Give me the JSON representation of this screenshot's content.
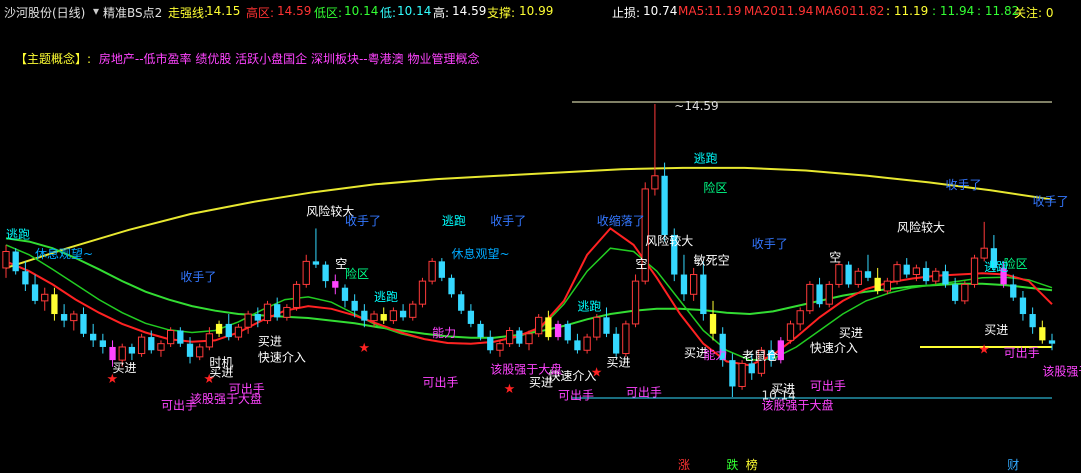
{
  "header": {
    "stock": "沙河股份(日线)",
    "indicator": "精准BS点2",
    "strong_label": "走强线:",
    "strong_value": "14.15",
    "high_zone_label": "高区:",
    "high_zone_value": "14.59",
    "low_zone_label": "低区:",
    "low_zone_value": "10.14",
    "low_label": "低:",
    "low_value": "10.14",
    "high_label": "高:",
    "high_value": "14.59",
    "support_label": "支撑:",
    "support_value": "10.99",
    "stop_label": "止损:",
    "stop_value": "10.74",
    "ma5_label": "MA5:",
    "ma5_value": "11.19",
    "ma20_label": "MA20:",
    "ma20_value": "11.94",
    "ma60_label": "MA60:",
    "ma60_value": "11.82",
    "extra1": ": 11.19",
    "extra2": ": 11.94",
    "extra3": ": 11.82",
    "focus_label": "关注: 0"
  },
  "concept": {
    "prefix": "【主题概念】:",
    "text": "房地产--低市盈率 绩优股 活跃小盘国企 深圳板块--粤港澳 物业管理概念"
  },
  "colors": {
    "up": "#ff3a3a",
    "down": "#35d8ff",
    "yellow": "#ffff33",
    "magenta": "#ff44ff",
    "ma_yellow": "#e8e830",
    "ma_green": "#33dd33",
    "ma_red": "#ff2222",
    "white": "#ffffff",
    "cyan": "#00ffff"
  },
  "chart_data": {
    "type": "candlestick",
    "price_markers": {
      "high": "14.59",
      "low": "10.14"
    },
    "candles": [
      {
        "o": 12.1,
        "h": 12.45,
        "l": 11.95,
        "c": 12.35
      },
      {
        "o": 12.35,
        "h": 12.4,
        "l": 12.0,
        "c": 12.05
      },
      {
        "o": 12.05,
        "h": 12.2,
        "l": 11.75,
        "c": 11.85
      },
      {
        "o": 11.85,
        "h": 12.0,
        "l": 11.55,
        "c": 11.6
      },
      {
        "o": 11.6,
        "h": 11.8,
        "l": 11.45,
        "c": 11.7
      },
      {
        "o": 11.7,
        "h": 11.8,
        "l": 11.3,
        "c": 11.4
      },
      {
        "o": 11.4,
        "h": 11.55,
        "l": 11.2,
        "c": 11.3
      },
      {
        "o": 11.3,
        "h": 11.45,
        "l": 11.15,
        "c": 11.4
      },
      {
        "o": 11.4,
        "h": 11.5,
        "l": 11.05,
        "c": 11.1
      },
      {
        "o": 11.1,
        "h": 11.25,
        "l": 10.9,
        "c": 11.0
      },
      {
        "o": 11.0,
        "h": 11.1,
        "l": 10.8,
        "c": 10.9
      },
      {
        "o": 10.9,
        "h": 11.0,
        "l": 10.6,
        "c": 10.7
      },
      {
        "o": 10.7,
        "h": 10.95,
        "l": 10.6,
        "c": 10.9
      },
      {
        "o": 10.9,
        "h": 10.95,
        "l": 10.7,
        "c": 10.8
      },
      {
        "o": 10.8,
        "h": 11.1,
        "l": 10.75,
        "c": 11.05
      },
      {
        "o": 11.05,
        "h": 11.15,
        "l": 10.8,
        "c": 10.85
      },
      {
        "o": 10.85,
        "h": 11.0,
        "l": 10.75,
        "c": 10.95
      },
      {
        "o": 10.95,
        "h": 11.2,
        "l": 10.9,
        "c": 11.15
      },
      {
        "o": 11.15,
        "h": 11.2,
        "l": 10.9,
        "c": 10.95
      },
      {
        "o": 10.95,
        "h": 11.05,
        "l": 10.65,
        "c": 10.75
      },
      {
        "o": 10.75,
        "h": 10.95,
        "l": 10.7,
        "c": 10.9
      },
      {
        "o": 10.9,
        "h": 11.2,
        "l": 10.85,
        "c": 11.1
      },
      {
        "o": 11.1,
        "h": 11.3,
        "l": 11.05,
        "c": 11.25
      },
      {
        "o": 11.25,
        "h": 11.4,
        "l": 11.0,
        "c": 11.05
      },
      {
        "o": 11.05,
        "h": 11.25,
        "l": 11.0,
        "c": 11.2
      },
      {
        "o": 11.2,
        "h": 11.45,
        "l": 11.1,
        "c": 11.4
      },
      {
        "o": 11.4,
        "h": 11.5,
        "l": 11.2,
        "c": 11.3
      },
      {
        "o": 11.3,
        "h": 11.6,
        "l": 11.25,
        "c": 11.55
      },
      {
        "o": 11.55,
        "h": 11.65,
        "l": 11.3,
        "c": 11.35
      },
      {
        "o": 11.35,
        "h": 11.55,
        "l": 11.3,
        "c": 11.5
      },
      {
        "o": 11.5,
        "h": 11.9,
        "l": 11.45,
        "c": 11.85
      },
      {
        "o": 11.85,
        "h": 12.3,
        "l": 11.8,
        "c": 12.2
      },
      {
        "o": 12.2,
        "h": 12.7,
        "l": 12.1,
        "c": 12.15
      },
      {
        "o": 12.15,
        "h": 12.2,
        "l": 11.8,
        "c": 11.9
      },
      {
        "o": 11.9,
        "h": 12.0,
        "l": 11.7,
        "c": 11.8
      },
      {
        "o": 11.8,
        "h": 11.85,
        "l": 11.5,
        "c": 11.6
      },
      {
        "o": 11.6,
        "h": 11.7,
        "l": 11.35,
        "c": 11.45
      },
      {
        "o": 11.45,
        "h": 11.55,
        "l": 11.2,
        "c": 11.3
      },
      {
        "o": 11.3,
        "h": 11.45,
        "l": 11.2,
        "c": 11.4
      },
      {
        "o": 11.4,
        "h": 11.5,
        "l": 11.25,
        "c": 11.3
      },
      {
        "o": 11.3,
        "h": 11.5,
        "l": 11.25,
        "c": 11.45
      },
      {
        "o": 11.45,
        "h": 11.55,
        "l": 11.3,
        "c": 11.35
      },
      {
        "o": 11.35,
        "h": 11.6,
        "l": 11.3,
        "c": 11.55
      },
      {
        "o": 11.55,
        "h": 11.95,
        "l": 11.5,
        "c": 11.9
      },
      {
        "o": 11.9,
        "h": 12.25,
        "l": 11.85,
        "c": 12.2
      },
      {
        "o": 12.2,
        "h": 12.25,
        "l": 11.9,
        "c": 11.95
      },
      {
        "o": 11.95,
        "h": 12.0,
        "l": 11.65,
        "c": 11.7
      },
      {
        "o": 11.7,
        "h": 11.75,
        "l": 11.4,
        "c": 11.45
      },
      {
        "o": 11.45,
        "h": 11.55,
        "l": 11.2,
        "c": 11.25
      },
      {
        "o": 11.25,
        "h": 11.3,
        "l": 11.0,
        "c": 11.05
      },
      {
        "o": 11.05,
        "h": 11.15,
        "l": 10.8,
        "c": 10.85
      },
      {
        "o": 10.85,
        "h": 11.0,
        "l": 10.75,
        "c": 10.95
      },
      {
        "o": 10.95,
        "h": 11.2,
        "l": 10.9,
        "c": 11.15
      },
      {
        "o": 11.15,
        "h": 11.2,
        "l": 10.9,
        "c": 10.95
      },
      {
        "o": 10.95,
        "h": 11.15,
        "l": 10.85,
        "c": 11.1
      },
      {
        "o": 11.1,
        "h": 11.4,
        "l": 11.05,
        "c": 11.35
      },
      {
        "o": 11.35,
        "h": 11.45,
        "l": 11.0,
        "c": 11.05
      },
      {
        "o": 11.05,
        "h": 11.3,
        "l": 11.0,
        "c": 11.25
      },
      {
        "o": 11.25,
        "h": 11.3,
        "l": 10.95,
        "c": 11.0
      },
      {
        "o": 11.0,
        "h": 11.1,
        "l": 10.8,
        "c": 10.85
      },
      {
        "o": 10.85,
        "h": 11.1,
        "l": 10.8,
        "c": 11.05
      },
      {
        "o": 11.05,
        "h": 11.4,
        "l": 11.0,
        "c": 11.35
      },
      {
        "o": 11.35,
        "h": 11.5,
        "l": 11.05,
        "c": 11.1
      },
      {
        "o": 11.1,
        "h": 11.2,
        "l": 10.75,
        "c": 10.8
      },
      {
        "o": 10.8,
        "h": 11.3,
        "l": 10.75,
        "c": 11.25
      },
      {
        "o": 11.25,
        "h": 12.0,
        "l": 11.2,
        "c": 11.9
      },
      {
        "o": 11.9,
        "h": 13.4,
        "l": 11.85,
        "c": 13.3
      },
      {
        "o": 13.3,
        "h": 14.59,
        "l": 13.2,
        "c": 13.5
      },
      {
        "o": 13.5,
        "h": 13.7,
        "l": 12.5,
        "c": 12.6
      },
      {
        "o": 12.6,
        "h": 12.7,
        "l": 11.9,
        "c": 12.0
      },
      {
        "o": 12.0,
        "h": 12.3,
        "l": 11.6,
        "c": 11.7
      },
      {
        "o": 11.7,
        "h": 12.1,
        "l": 11.6,
        "c": 12.0
      },
      {
        "o": 12.0,
        "h": 12.2,
        "l": 11.3,
        "c": 11.4
      },
      {
        "o": 11.4,
        "h": 11.6,
        "l": 11.0,
        "c": 11.1
      },
      {
        "o": 11.1,
        "h": 11.2,
        "l": 10.6,
        "c": 10.7
      },
      {
        "o": 10.7,
        "h": 10.8,
        "l": 10.14,
        "c": 10.3
      },
      {
        "o": 10.3,
        "h": 10.7,
        "l": 10.25,
        "c": 10.65
      },
      {
        "o": 10.65,
        "h": 10.8,
        "l": 10.4,
        "c": 10.5
      },
      {
        "o": 10.5,
        "h": 10.9,
        "l": 10.45,
        "c": 10.85
      },
      {
        "o": 10.85,
        "h": 11.0,
        "l": 10.6,
        "c": 10.7
      },
      {
        "o": 10.7,
        "h": 11.05,
        "l": 10.65,
        "c": 11.0
      },
      {
        "o": 11.0,
        "h": 11.3,
        "l": 10.95,
        "c": 11.25
      },
      {
        "o": 11.25,
        "h": 11.5,
        "l": 11.15,
        "c": 11.45
      },
      {
        "o": 11.45,
        "h": 11.9,
        "l": 11.4,
        "c": 11.85
      },
      {
        "o": 11.85,
        "h": 11.95,
        "l": 11.5,
        "c": 11.55
      },
      {
        "o": 11.55,
        "h": 11.9,
        "l": 11.5,
        "c": 11.85
      },
      {
        "o": 11.85,
        "h": 12.2,
        "l": 11.8,
        "c": 12.15
      },
      {
        "o": 12.15,
        "h": 12.2,
        "l": 11.8,
        "c": 11.85
      },
      {
        "o": 11.85,
        "h": 12.1,
        "l": 11.8,
        "c": 12.05
      },
      {
        "o": 12.05,
        "h": 12.3,
        "l": 11.9,
        "c": 11.95
      },
      {
        "o": 11.95,
        "h": 12.1,
        "l": 11.7,
        "c": 11.75
      },
      {
        "o": 11.75,
        "h": 11.95,
        "l": 11.7,
        "c": 11.9
      },
      {
        "o": 11.9,
        "h": 12.2,
        "l": 11.85,
        "c": 12.15
      },
      {
        "o": 12.15,
        "h": 12.25,
        "l": 11.95,
        "c": 12.0
      },
      {
        "o": 12.0,
        "h": 12.15,
        "l": 11.9,
        "c": 12.1
      },
      {
        "o": 12.1,
        "h": 12.2,
        "l": 11.85,
        "c": 11.9
      },
      {
        "o": 11.9,
        "h": 12.1,
        "l": 11.85,
        "c": 12.05
      },
      {
        "o": 12.05,
        "h": 12.15,
        "l": 11.8,
        "c": 11.85
      },
      {
        "o": 11.85,
        "h": 11.95,
        "l": 11.55,
        "c": 11.6
      },
      {
        "o": 11.6,
        "h": 11.9,
        "l": 11.55,
        "c": 11.85
      },
      {
        "o": 11.85,
        "h": 12.3,
        "l": 11.8,
        "c": 12.25
      },
      {
        "o": 12.25,
        "h": 12.8,
        "l": 12.2,
        "c": 12.4
      },
      {
        "o": 12.4,
        "h": 12.6,
        "l": 12.05,
        "c": 12.1
      },
      {
        "o": 12.1,
        "h": 12.2,
        "l": 11.8,
        "c": 11.85
      },
      {
        "o": 11.85,
        "h": 12.0,
        "l": 11.6,
        "c": 11.65
      },
      {
        "o": 11.65,
        "h": 11.75,
        "l": 11.3,
        "c": 11.4
      },
      {
        "o": 11.4,
        "h": 11.5,
        "l": 11.1,
        "c": 11.2
      },
      {
        "o": 11.2,
        "h": 11.3,
        "l": 10.95,
        "c": 11.0
      },
      {
        "o": 11.0,
        "h": 11.1,
        "l": 10.85,
        "c": 10.95
      }
    ],
    "ma_yellow": [
      12.1,
      12.4,
      12.68,
      12.92,
      13.1,
      13.25,
      13.37,
      13.45,
      13.5,
      13.55,
      13.6,
      13.62,
      13.62,
      13.58,
      13.5,
      13.4,
      13.28,
      13.14
    ],
    "ma_green_fast": [
      12.45,
      12.3,
      12.08,
      11.85,
      11.62,
      11.42,
      11.26,
      11.16,
      11.12,
      11.15,
      11.28,
      11.46,
      11.62,
      11.66,
      11.58,
      11.4,
      11.22,
      11.1,
      11.02,
      10.96,
      10.95,
      10.98,
      11.05,
      11.18,
      11.55,
      12.05,
      12.4,
      12.35,
      12.05,
      11.6,
      11.15,
      10.85,
      10.7,
      10.72,
      10.9,
      11.15,
      11.4,
      11.6,
      11.72,
      11.8,
      11.85,
      11.9,
      11.95,
      11.96,
      11.92,
      11.8
    ],
    "ma_green_slow": [
      12.55,
      12.5,
      12.4,
      12.25,
      12.08,
      11.9,
      11.74,
      11.62,
      11.52,
      11.45,
      11.4,
      11.38,
      11.36,
      11.34,
      11.3,
      11.26,
      11.2,
      11.15,
      11.1,
      11.06,
      11.04,
      11.04,
      11.08,
      11.14,
      11.22,
      11.32,
      11.4,
      11.45,
      11.48,
      11.48,
      11.46,
      11.42,
      11.4,
      11.44,
      11.52,
      11.6,
      11.68,
      11.74,
      11.78,
      11.82,
      11.84,
      11.86,
      11.86,
      11.84,
      11.8,
      11.76
    ],
    "ma_red": [
      12.2,
      12.05,
      11.85,
      11.62,
      11.42,
      11.25,
      11.12,
      11.02,
      10.98,
      11.0,
      11.12,
      11.3,
      11.45,
      11.52,
      11.48,
      11.38,
      11.25,
      11.12,
      11.02,
      10.96,
      10.95,
      10.98,
      11.06,
      11.2,
      11.6,
      12.3,
      12.7,
      12.45,
      11.95,
      11.4,
      10.95,
      10.68,
      10.62,
      10.78,
      11.05,
      11.35,
      11.6,
      11.78,
      11.88,
      11.94,
      11.98,
      12.0,
      12.02,
      12.0,
      11.9,
      11.55
    ],
    "annotations": [
      {
        "text": "逃跑",
        "i": 0,
        "p": 12.55,
        "color": "#00ffff"
      },
      {
        "text": "休息观望~",
        "i": 3,
        "p": 12.25,
        "color": "#00aaff"
      },
      {
        "text": "收手了",
        "i": 18,
        "p": 11.9,
        "color": "#3377ff"
      },
      {
        "text": "风险较大",
        "i": 31,
        "p": 12.9,
        "color": "#ffffff"
      },
      {
        "text": "收手了",
        "i": 35,
        "p": 12.75,
        "color": "#3377ff"
      },
      {
        "text": "逃跑",
        "i": 45,
        "p": 12.75,
        "color": "#00ffff"
      },
      {
        "text": "收手了",
        "i": 50,
        "p": 12.75,
        "color": "#3377ff"
      },
      {
        "text": "休息观望~",
        "i": 46,
        "p": 12.25,
        "color": "#00aaff"
      },
      {
        "text": "收缩落了",
        "i": 61,
        "p": 12.75,
        "color": "#3377ff"
      },
      {
        "text": "风险较大",
        "i": 66,
        "p": 12.45,
        "color": "#ffffff"
      },
      {
        "text": "逃跑",
        "i": 71,
        "p": 13.7,
        "color": "#00ffff"
      },
      {
        "text": "收手了",
        "i": 77,
        "p": 12.4,
        "color": "#3377ff"
      },
      {
        "text": "收手了",
        "i": 97,
        "p": 13.3,
        "color": "#3377ff"
      },
      {
        "text": "风险较大",
        "i": 92,
        "p": 12.65,
        "color": "#ffffff"
      },
      {
        "text": "收手了",
        "i": 106,
        "p": 13.05,
        "color": "#3377ff"
      },
      {
        "text": "买进",
        "i": 11,
        "p": 10.52,
        "color": "#ffffff"
      },
      {
        "text": "买进",
        "i": 21,
        "p": 10.45,
        "color": "#ffffff"
      },
      {
        "text": "时机",
        "i": 21,
        "p": 10.6,
        "color": "#ffffff"
      },
      {
        "text": "快速介入",
        "i": 26,
        "p": 10.68,
        "color": "#ffffff"
      },
      {
        "text": "买进",
        "i": 26,
        "p": 10.92,
        "color": "#ffffff"
      },
      {
        "text": "快速介入",
        "i": 56,
        "p": 10.4,
        "color": "#ffffff"
      },
      {
        "text": "买进",
        "i": 54,
        "p": 10.3,
        "color": "#ffffff"
      },
      {
        "text": "买进",
        "i": 62,
        "p": 10.6,
        "color": "#ffffff"
      },
      {
        "text": "买进",
        "i": 70,
        "p": 10.75,
        "color": "#ffffff"
      },
      {
        "text": "买进",
        "i": 79,
        "p": 10.2,
        "color": "#ffffff"
      },
      {
        "text": "快速介入",
        "i": 83,
        "p": 10.82,
        "color": "#ffffff"
      },
      {
        "text": "买进",
        "i": 86,
        "p": 11.05,
        "color": "#ffffff"
      },
      {
        "text": "买进",
        "i": 101,
        "p": 11.1,
        "color": "#ffffff"
      },
      {
        "text": "可出手",
        "i": 16,
        "p": 9.95,
        "color": "#ff44ff"
      },
      {
        "text": "可出手",
        "i": 23,
        "p": 10.2,
        "color": "#ff44ff"
      },
      {
        "text": "该股强于大盘",
        "i": 19,
        "p": 10.05,
        "color": "#ff44ff"
      },
      {
        "text": "可出手",
        "i": 43,
        "p": 10.3,
        "color": "#ff44ff"
      },
      {
        "text": "该股强于大盘",
        "i": 50,
        "p": 10.5,
        "color": "#ff44ff"
      },
      {
        "text": "可出手",
        "i": 57,
        "p": 10.1,
        "color": "#ff44ff"
      },
      {
        "text": "可出手",
        "i": 64,
        "p": 10.15,
        "color": "#ff44ff"
      },
      {
        "text": "可出手",
        "i": 83,
        "p": 10.25,
        "color": "#ff44ff"
      },
      {
        "text": "该股强于大盘",
        "i": 78,
        "p": 9.95,
        "color": "#ff44ff"
      },
      {
        "text": "可出手",
        "i": 103,
        "p": 10.75,
        "color": "#ff44ff"
      },
      {
        "text": "该股强于大盘",
        "i": 107,
        "p": 10.47,
        "color": "#ff44ff"
      },
      {
        "text": "能力",
        "i": 44,
        "p": 11.05,
        "color": "#ff44ff"
      },
      {
        "text": "能力",
        "i": 72,
        "p": 10.72,
        "color": "#ff44ff"
      },
      {
        "text": "老鼠仓",
        "i": 76,
        "p": 10.7,
        "color": "#ffffff"
      },
      {
        "text": "敏死空",
        "i": 71,
        "p": 12.15,
        "color": "#ffffff"
      },
      {
        "text": "空",
        "i": 34,
        "p": 12.1,
        "color": "#ffffff"
      },
      {
        "text": "空",
        "i": 65,
        "p": 12.1,
        "color": "#ffffff"
      },
      {
        "text": "空",
        "i": 85,
        "p": 12.2,
        "color": "#ffffff"
      },
      {
        "text": "险区",
        "i": 35,
        "p": 11.95,
        "color": "#00ff88"
      },
      {
        "text": "险区",
        "i": 72,
        "p": 13.25,
        "color": "#00ff88"
      },
      {
        "text": "险区",
        "i": 103,
        "p": 12.1,
        "color": "#00ff88"
      },
      {
        "text": "逃跑",
        "i": 38,
        "p": 11.6,
        "color": "#00ffff"
      },
      {
        "text": "逃跑",
        "i": 59,
        "p": 11.45,
        "color": "#00ffff"
      },
      {
        "text": "逃跑",
        "i": 101,
        "p": 12.05,
        "color": "#00ffff"
      },
      {
        "text": "~14.59",
        "i": 69,
        "p": 14.5,
        "color": "#dddddd"
      },
      {
        "text": "10.14",
        "i": 78,
        "p": 10.1,
        "color": "#dddddd"
      }
    ],
    "stars": [
      {
        "i": 11,
        "p": 10.35
      },
      {
        "i": 21,
        "p": 10.35
      },
      {
        "i": 37,
        "p": 10.82
      },
      {
        "i": 52,
        "p": 10.2
      },
      {
        "i": 61,
        "p": 10.45
      },
      {
        "i": 101,
        "p": 10.8
      }
    ],
    "bottom_tags": [
      {
        "text": "涨",
        "i": 70,
        "color": "#ff3333"
      },
      {
        "text": "跌",
        "i": 75,
        "color": "#33ff33"
      },
      {
        "text": "榜",
        "i": 77,
        "color": "#ffff33"
      },
      {
        "text": "财",
        "i": 104,
        "color": "#33aaff"
      }
    ]
  }
}
